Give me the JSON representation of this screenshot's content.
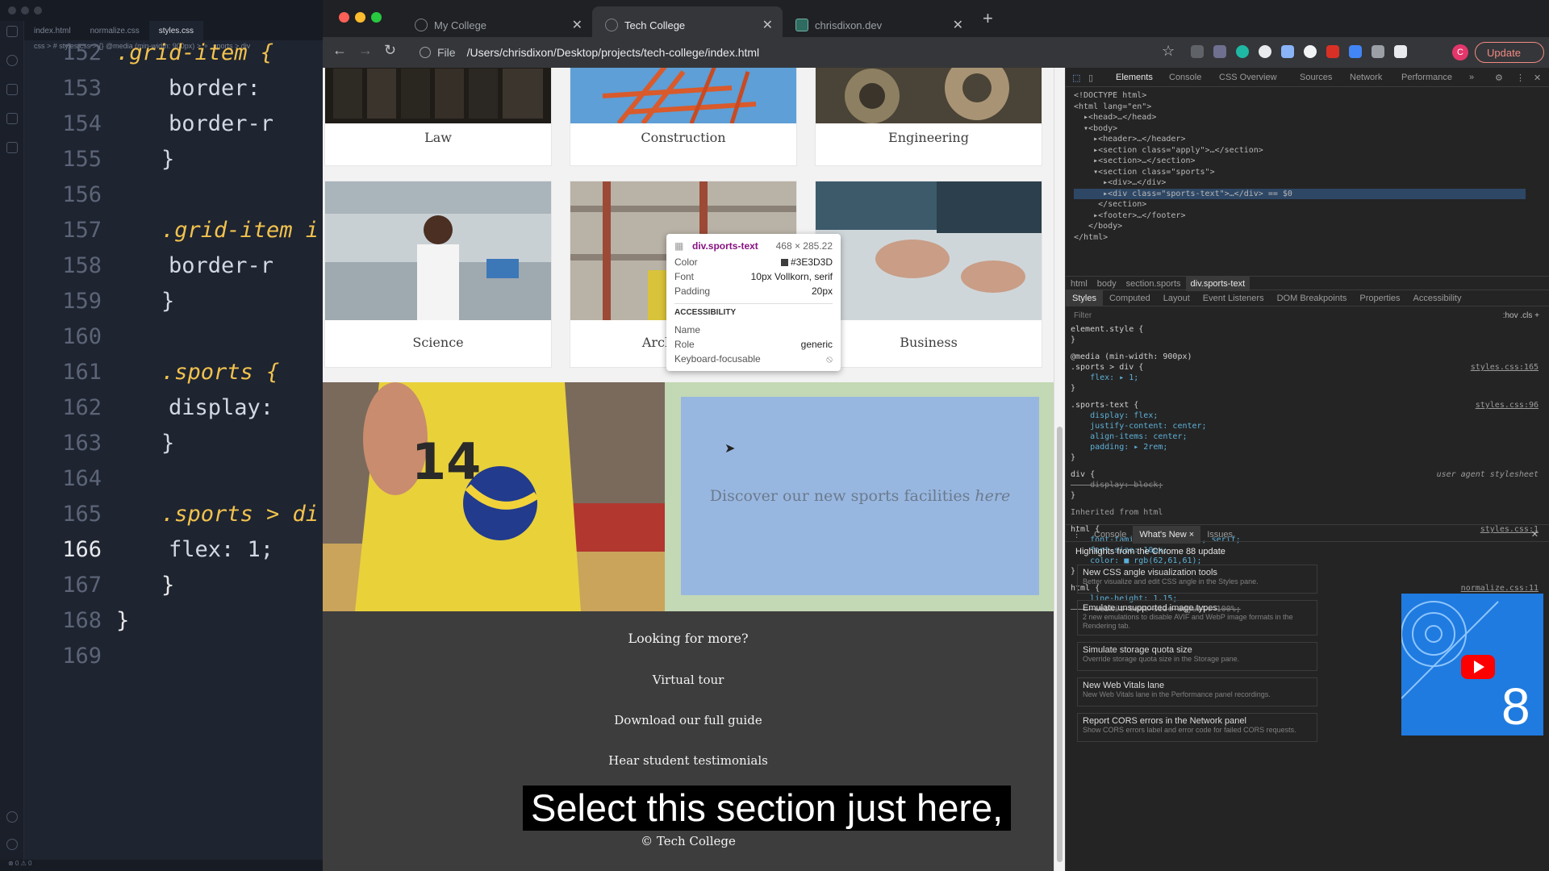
{
  "editor": {
    "tabs": [
      "index.html",
      "normalize.css",
      "styles.css"
    ],
    "breadcrumb": "css > # styles.css > {} @media (min-width: 900px) > ⚬ .sports > div",
    "lines": [
      {
        "num": "152",
        "text": ".grid-item {"
      },
      {
        "num": "153",
        "text": "    border:"
      },
      {
        "num": "154",
        "text": "    border-r"
      },
      {
        "num": "155",
        "text": "}"
      },
      {
        "num": "156",
        "text": ""
      },
      {
        "num": "157",
        "text": ".grid-item i"
      },
      {
        "num": "158",
        "text": "    border-r"
      },
      {
        "num": "159",
        "text": "}"
      },
      {
        "num": "160",
        "text": ""
      },
      {
        "num": "161",
        "text": ".sports {"
      },
      {
        "num": "162",
        "text": "    display:"
      },
      {
        "num": "163",
        "text": "}"
      },
      {
        "num": "164",
        "text": ""
      },
      {
        "num": "165",
        "text": ".sports > di"
      },
      {
        "num": "166",
        "text": "    flex: 1;"
      },
      {
        "num": "167",
        "text": "}"
      },
      {
        "num": "168",
        "text": "}"
      },
      {
        "num": "169",
        "text": ""
      }
    ],
    "current_line": "166",
    "status": "⊗ 0 ⚠ 0"
  },
  "browser": {
    "tabs": [
      {
        "title": "My College"
      },
      {
        "title": "Tech College"
      },
      {
        "title": "chrisdixon.dev"
      }
    ],
    "active_tab": 1,
    "url_scheme": "File",
    "url": "/Users/chrisdixon/Desktop/projects/tech-college/index.html",
    "avatar_letter": "C",
    "update_label": "Update"
  },
  "page": {
    "grid": [
      "Law",
      "Construction",
      "Engineering",
      "Science",
      "Architecture",
      "Business"
    ],
    "sports_number": "14",
    "sports_text": "Discover our new sports facilities",
    "sports_link": "here",
    "footer_heading": "Looking for more?",
    "footer_links": [
      "Virtual tour",
      "Download our full guide",
      "Hear student testimonials"
    ],
    "copyright": "© Tech College"
  },
  "inspect_tooltip": {
    "selector": "div.sports-text",
    "size": "468 × 285.22",
    "color_label": "Color",
    "color_value": "#3E3D3D",
    "font_label": "Font",
    "font_value": "10px Vollkorn, serif",
    "padding_label": "Padding",
    "padding_value": "20px",
    "section": "ACCESSIBILITY",
    "name_label": "Name",
    "role_label": "Role",
    "role_value": "generic",
    "focus_label": "Keyboard-focusable"
  },
  "caption": "Select this section just here,",
  "devtools": {
    "tabs": [
      "Elements",
      "Console",
      "CSS Overview",
      "Sources",
      "Network",
      "Performance",
      "»"
    ],
    "dom": [
      "<!DOCTYPE html>",
      "<html lang=\"en\">",
      "  ▸<head>…</head>",
      "  ▾<body>",
      "    ▸<header>…</header>",
      "    ▸<section class=\"apply\">…</section>",
      "    ▸<section>…</section>",
      "    ▾<section class=\"sports\">",
      "      ▸<div>…</div>",
      "      ▸<div class=\"sports-text\">…</div> == $0",
      "     </section>",
      "    ▸<footer>…</footer>",
      "   </body>",
      "</html>"
    ],
    "crumbs": [
      "html",
      "body",
      "section.sports",
      "div.sports-text"
    ],
    "subtabs": [
      "Styles",
      "Computed",
      "Layout",
      "Event Listeners",
      "DOM Breakpoints",
      "Properties",
      "Accessibility"
    ],
    "filter_placeholder": "Filter",
    "filter_tools": ":hov  .cls  +",
    "css": [
      {
        "text": "element.style {",
        "src": ""
      },
      {
        "text": "}",
        "src": ""
      },
      {
        "text": "@media (min-width: 900px)",
        "src": ""
      },
      {
        "text": ".sports > div {",
        "src": "styles.css:165"
      },
      {
        "text": "    flex: ▸ 1;",
        "src": ""
      },
      {
        "text": "}",
        "src": ""
      },
      {
        "text": ".sports-text {",
        "src": "styles.css:96"
      },
      {
        "text": "    display: flex;",
        "src": ""
      },
      {
        "text": "    justify-content: center;",
        "src": ""
      },
      {
        "text": "    align-items: center;",
        "src": ""
      },
      {
        "text": "    padding: ▸ 2rem;",
        "src": ""
      },
      {
        "text": "}",
        "src": ""
      },
      {
        "text": "div {",
        "src": "user agent stylesheet"
      },
      {
        "text": "    display: block;",
        "src": "",
        "strike": true
      },
      {
        "text": "}",
        "src": ""
      },
      {
        "text": "Inherited from html",
        "src": ""
      },
      {
        "text": "html {",
        "src": "styles.css:1"
      },
      {
        "text": "    font-family: 'Vollkorn', serif;",
        "src": ""
      },
      {
        "text": "    font-size: 10px;",
        "src": ""
      },
      {
        "text": "    color: ■ rgb(62,61,61);",
        "src": ""
      },
      {
        "text": "}",
        "src": ""
      },
      {
        "text": "html {",
        "src": "normalize.css:11"
      },
      {
        "text": "    line-height: 1.15;",
        "src": ""
      },
      {
        "text": "    -webkit-text-size-adjust: 100%;",
        "src": "",
        "strike": true
      }
    ],
    "drawer_tabs": [
      "Console",
      "What's New ×",
      "Issues"
    ],
    "whats_new_title": "Highlights from the Chrome 88 update",
    "news": [
      {
        "title": "New CSS angle visualization tools",
        "desc": "Better visualize and edit CSS angle in the Styles pane."
      },
      {
        "title": "Emulate unsupported image types",
        "desc": "2 new emulations to disable AVIF and WebP image formats in the Rendering tab."
      },
      {
        "title": "Simulate storage quota size",
        "desc": "Override storage quota size in the Storage pane."
      },
      {
        "title": "New Web Vitals lane",
        "desc": "New Web Vitals lane in the Performance panel recordings."
      },
      {
        "title": "Report CORS errors in the Network panel",
        "desc": "Show CORS errors label and error code for failed CORS requests."
      }
    ],
    "promo_number": "8"
  }
}
